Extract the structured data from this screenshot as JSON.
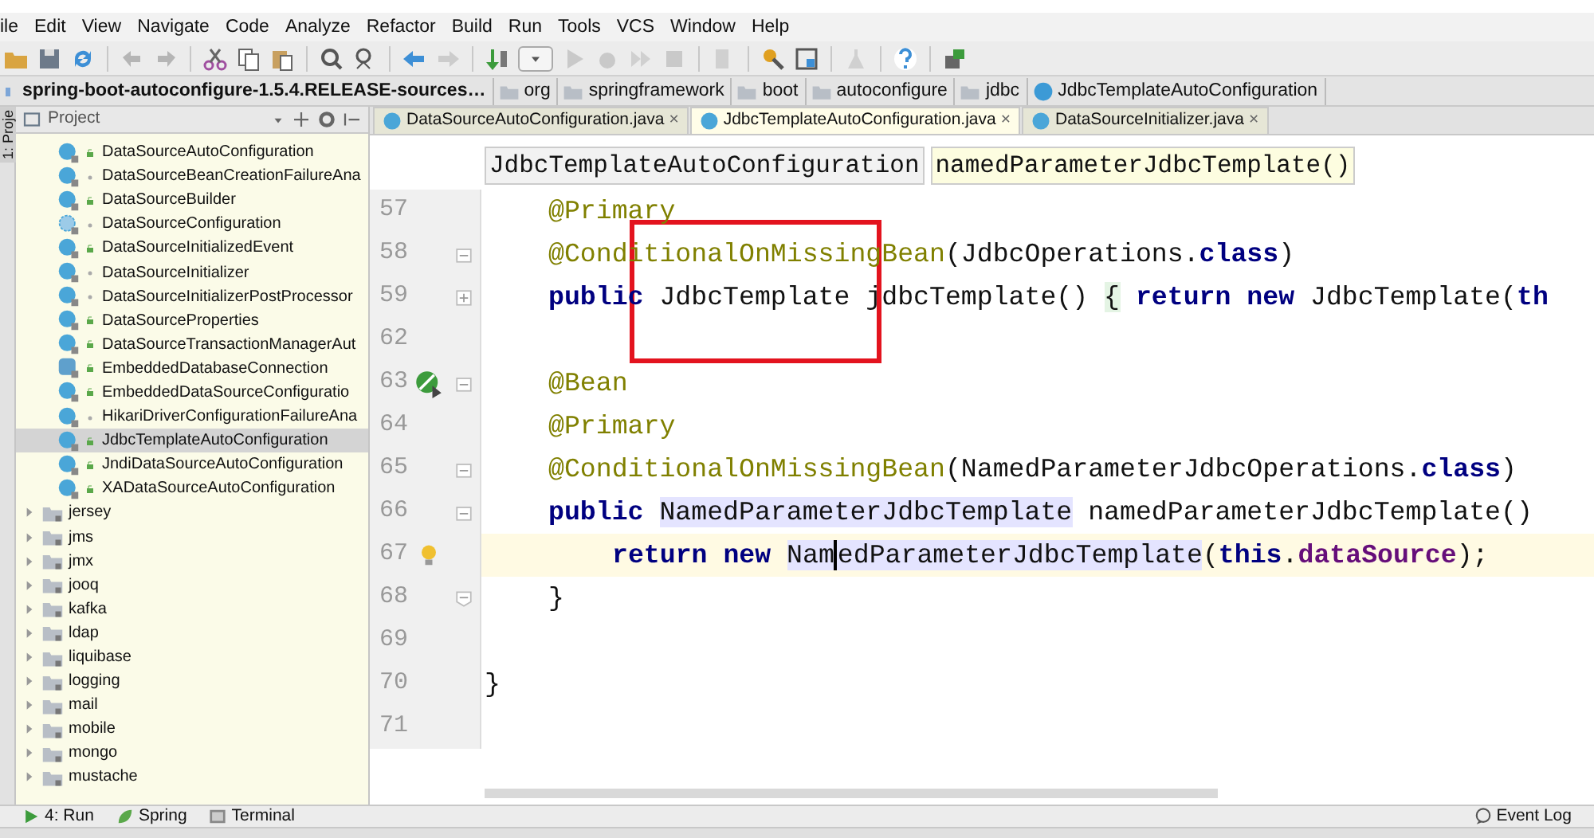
{
  "menu": [
    "ile",
    "Edit",
    "View",
    "Navigate",
    "Code",
    "Analyze",
    "Refactor",
    "Build",
    "Run",
    "Tools",
    "VCS",
    "Window",
    "Help"
  ],
  "nav_bar": [
    {
      "label": "spring-boot-autoconfigure-1.5.4.RELEASE-sources…",
      "kind": "module"
    },
    {
      "label": "org",
      "kind": "folder"
    },
    {
      "label": "springframework",
      "kind": "folder"
    },
    {
      "label": "boot",
      "kind": "folder"
    },
    {
      "label": "autoconfigure",
      "kind": "folder"
    },
    {
      "label": "jdbc",
      "kind": "folder"
    },
    {
      "label": "JdbcTemplateAutoConfiguration",
      "kind": "class"
    }
  ],
  "side_stripe": {
    "label": "1: Proje"
  },
  "project_panel": {
    "title": "Project",
    "classes": [
      {
        "label": "DataSourceAutoConfiguration",
        "kind": "class",
        "public": true,
        "selected": false
      },
      {
        "label": "DataSourceBeanCreationFailureAna",
        "kind": "class",
        "public": false,
        "selected": false
      },
      {
        "label": "DataSourceBuilder",
        "kind": "class",
        "public": true,
        "selected": false
      },
      {
        "label": "DataSourceConfiguration",
        "kind": "abstract",
        "public": false,
        "selected": false
      },
      {
        "label": "DataSourceInitializedEvent",
        "kind": "class",
        "public": true,
        "selected": false
      },
      {
        "label": "DataSourceInitializer",
        "kind": "class",
        "public": false,
        "selected": false
      },
      {
        "label": "DataSourceInitializerPostProcessor",
        "kind": "class",
        "public": false,
        "selected": false
      },
      {
        "label": "DataSourceProperties",
        "kind": "class",
        "public": true,
        "selected": false
      },
      {
        "label": "DataSourceTransactionManagerAut",
        "kind": "class",
        "public": true,
        "selected": false
      },
      {
        "label": "EmbeddedDatabaseConnection",
        "kind": "enum",
        "public": true,
        "selected": false
      },
      {
        "label": "EmbeddedDataSourceConfiguratio",
        "kind": "class",
        "public": true,
        "selected": false
      },
      {
        "label": "HikariDriverConfigurationFailureAna",
        "kind": "class",
        "public": false,
        "selected": false
      },
      {
        "label": "JdbcTemplateAutoConfiguration",
        "kind": "class",
        "public": true,
        "selected": true
      },
      {
        "label": "JndiDataSourceAutoConfiguration",
        "kind": "class",
        "public": true,
        "selected": false
      },
      {
        "label": "XADataSourceAutoConfiguration",
        "kind": "class",
        "public": true,
        "selected": false
      }
    ],
    "packages": [
      {
        "label": "jersey",
        "expanded": false
      },
      {
        "label": "jms",
        "expanded": false
      },
      {
        "label": "jmx",
        "expanded": false
      },
      {
        "label": "jooq",
        "expanded": false
      },
      {
        "label": "kafka",
        "expanded": false
      },
      {
        "label": "ldap",
        "expanded": false
      },
      {
        "label": "liquibase",
        "expanded": false
      },
      {
        "label": "logging",
        "expanded": false
      },
      {
        "label": "mail",
        "expanded": false
      },
      {
        "label": "mobile",
        "expanded": false
      },
      {
        "label": "mongo",
        "expanded": false
      },
      {
        "label": "mustache",
        "expanded": false
      }
    ]
  },
  "editor_tabs": [
    {
      "label": "DataSourceAutoConfiguration.java",
      "close": "×",
      "selected": false
    },
    {
      "label": "JdbcTemplateAutoConfiguration.java",
      "close": "×",
      "selected": true
    },
    {
      "label": "DataSourceInitializer.java",
      "close": "×",
      "selected": false
    }
  ],
  "editor_breadcrumbs": [
    {
      "label": "JdbcTemplateAutoConfiguration",
      "selected": false
    },
    {
      "label": "namedParameterJdbcTemplate()",
      "selected": true
    }
  ],
  "code_lines": [
    {
      "number": "57",
      "current": false,
      "indent": {
        "kind": "single"
      },
      "tokens": [
        {
          "t": "@Primary",
          "kind": "annotation"
        }
      ]
    },
    {
      "number": "58",
      "current": false,
      "fold": {
        "kind": "open"
      },
      "indent": {
        "kind": "single"
      },
      "tokens": [
        {
          "t": "@ConditionalOnMissingBean",
          "kind": "annotation"
        },
        {
          "t": "(JdbcOperations.",
          "kind": "plain"
        },
        {
          "t": "class",
          "kind": "keyword"
        },
        {
          "t": ")",
          "kind": "plain"
        }
      ]
    },
    {
      "number": "59",
      "current": false,
      "fold": {
        "kind": "closed"
      },
      "indent": {
        "kind": "single"
      },
      "tokens": [
        {
          "t": "public",
          "kind": "keyword"
        },
        {
          "t": " JdbcTemplate jdbcTemplate() ",
          "kind": "plain"
        },
        {
          "t": "{",
          "kind": "folded"
        },
        {
          "t": " return",
          "kind": "keyword"
        },
        {
          "t": " new",
          "kind": "keyword"
        },
        {
          "t": " JdbcTemplate(",
          "kind": "plain"
        },
        {
          "t": "th",
          "kind": "keyword"
        }
      ]
    },
    {
      "number": "62",
      "current": false
    },
    {
      "number": "63",
      "current": false,
      "fold": {
        "kind": "open"
      },
      "marker": {
        "kind": "bean"
      },
      "indent": {
        "kind": "single"
      },
      "tokens": [
        {
          "t": "@Bean",
          "kind": "annotation"
        }
      ]
    },
    {
      "number": "64",
      "current": false,
      "indent": {
        "kind": "single"
      },
      "tokens": [
        {
          "t": "@Primary",
          "kind": "annotation"
        }
      ]
    },
    {
      "number": "65",
      "current": false,
      "fold": {
        "kind": "open"
      },
      "indent": {
        "kind": "single"
      },
      "tokens": [
        {
          "t": "@ConditionalOnMissingBean",
          "kind": "annotation"
        },
        {
          "t": "(NamedParameterJdbcOperations.",
          "kind": "plain"
        },
        {
          "t": "class",
          "kind": "keyword"
        },
        {
          "t": ")",
          "kind": "plain"
        }
      ]
    },
    {
      "number": "66",
      "current": false,
      "fold": {
        "kind": "open"
      },
      "indent": {
        "kind": "single"
      },
      "tokens": [
        {
          "t": "public ",
          "kind": "keyword"
        },
        {
          "t": "NamedParameterJdbcTemplate",
          "kind": "usage"
        },
        {
          "t": " namedParameterJdbcTemplate()",
          "kind": "plain"
        }
      ]
    },
    {
      "number": "67",
      "current": true,
      "marker": {
        "kind": "bulb"
      },
      "indent": {
        "kind": "double"
      },
      "tokens": [
        {
          "t": "return",
          "kind": "keyword"
        },
        {
          "t": " new ",
          "kind": "keyword"
        },
        {
          "t": "Nam",
          "kind": "usage",
          "caret_after": true
        },
        {
          "t": "edParameterJdbcTemplate",
          "kind": "usage",
          "caret_after": false
        },
        {
          "t": "(",
          "kind": "plain"
        },
        {
          "t": "this",
          "kind": "keyword"
        },
        {
          "t": ".",
          "kind": "plain"
        },
        {
          "t": "dataSource",
          "kind": "field"
        },
        {
          "t": ");",
          "kind": "plain"
        }
      ]
    },
    {
      "number": "68",
      "current": false,
      "fold": {
        "kind": "end"
      },
      "indent": {
        "kind": "single"
      },
      "tokens": [
        {
          "t": "}",
          "kind": "plain"
        }
      ]
    },
    {
      "number": "69",
      "current": false
    },
    {
      "number": "70",
      "current": false,
      "tokens": [
        {
          "t": "}",
          "kind": "plain"
        }
      ]
    },
    {
      "number": "71",
      "current": false
    }
  ],
  "bottom_tools": [
    {
      "label": "4: Run",
      "kind": "run"
    },
    {
      "label": "Spring",
      "kind": "spring"
    },
    {
      "label": "Terminal",
      "kind": "terminal"
    }
  ],
  "event_log": {
    "label": "Event Log"
  }
}
